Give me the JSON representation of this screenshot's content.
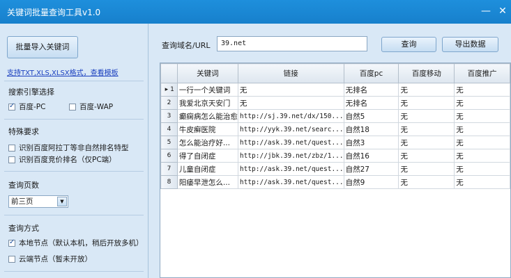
{
  "window": {
    "title": "关键词批量查询工具v1.0",
    "min_glyph": "—",
    "close_glyph": "✕"
  },
  "left": {
    "import_button": "批量导入关键词",
    "format_link": "支持TXT,XLS,XLSX格式，查看模板",
    "engine": {
      "label": "搜索引擎选择",
      "options": [
        {
          "label": "百度-PC",
          "checked": true
        },
        {
          "label": "百度-WAP",
          "checked": false
        }
      ]
    },
    "special": {
      "label": "特殊要求",
      "options": [
        {
          "label": "识别百度阿拉丁等非自然排名特型",
          "checked": false
        },
        {
          "label": "识别百度竞价排名（仅PC端）",
          "checked": false
        }
      ]
    },
    "pages": {
      "label": "查询页数",
      "selected": "前三页",
      "arrow": "▼"
    },
    "method": {
      "label": "查询方式",
      "options": [
        {
          "label": "本地节点（默认本机，稍后开放多机）",
          "checked": true
        },
        {
          "label": "云端节点（暂未开放）",
          "checked": false
        }
      ]
    }
  },
  "right": {
    "domain_label": "查询域名/URL",
    "domain_value": "39.net",
    "query_button": "查询",
    "export_button": "导出数据",
    "grid": {
      "columns": [
        "关键词",
        "链接",
        "百度pc",
        "百度移动",
        "百度推广"
      ],
      "current_marker": "▸",
      "rows": [
        [
          "1",
          "一行一个关键词",
          "无",
          "无排名",
          "无",
          "无"
        ],
        [
          "2",
          "我爱北京天安门",
          "无",
          "无排名",
          "无",
          "无"
        ],
        [
          "3",
          "癫痫病怎么能治愈",
          "http://sj.39.net/dx/150...",
          "自然5",
          "无",
          "无"
        ],
        [
          "4",
          "牛皮癣医院",
          "http://yyk.39.net/searc...",
          "自然18",
          "无",
          "无"
        ],
        [
          "5",
          "怎么能治疗好...",
          "http://ask.39.net/quest...",
          "自然3",
          "无",
          "无"
        ],
        [
          "6",
          "得了自闭症",
          "http://jbk.39.net/zbz/1...",
          "自然16",
          "无",
          "无"
        ],
        [
          "7",
          "儿童自闭症",
          "http://ask.39.net/quest...",
          "自然27",
          "无",
          "无"
        ],
        [
          "8",
          "阳痿早泄怎么...",
          "http://ask.39.net/quest...",
          "自然9",
          "无",
          "无"
        ]
      ]
    }
  }
}
